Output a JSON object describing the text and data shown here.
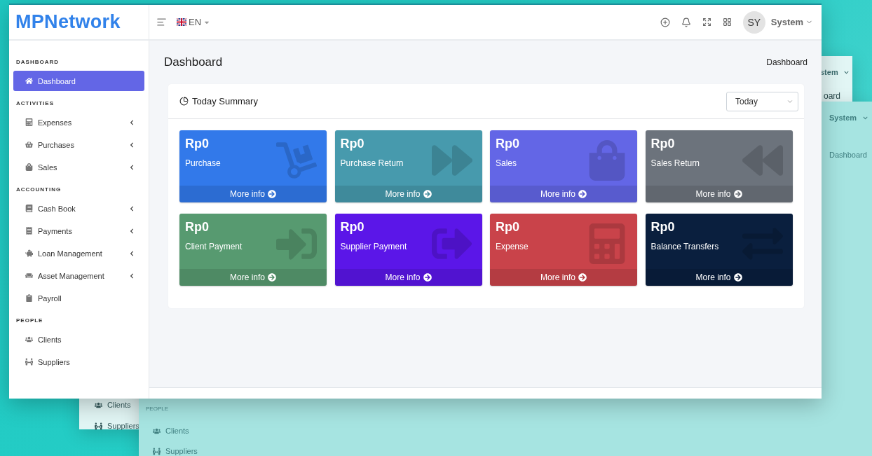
{
  "logo": "MPNetwork",
  "topbar": {
    "language": "EN",
    "avatar": "SY",
    "user": "System"
  },
  "sidebar": {
    "sections": [
      {
        "title": "DASHBOARD",
        "items": [
          {
            "label": "Dashboard",
            "selected": true,
            "expandable": false
          }
        ]
      },
      {
        "title": "ACTIVITIES",
        "items": [
          {
            "label": "Expenses",
            "selected": false,
            "expandable": true
          },
          {
            "label": "Purchases",
            "selected": false,
            "expandable": true
          },
          {
            "label": "Sales",
            "selected": false,
            "expandable": true
          }
        ]
      },
      {
        "title": "ACCOUNTING",
        "items": [
          {
            "label": "Cash Book",
            "selected": false,
            "expandable": true
          },
          {
            "label": "Payments",
            "selected": false,
            "expandable": true
          },
          {
            "label": "Loan Management",
            "selected": false,
            "expandable": true
          },
          {
            "label": "Asset Management",
            "selected": false,
            "expandable": true
          },
          {
            "label": "Payroll",
            "selected": false,
            "expandable": false
          }
        ]
      },
      {
        "title": "PEOPLE",
        "items": [
          {
            "label": "Clients",
            "selected": false,
            "expandable": false
          },
          {
            "label": "Suppliers",
            "selected": false,
            "expandable": false
          }
        ]
      }
    ]
  },
  "page": {
    "title": "Dashboard",
    "breadcrumb": "Dashboard"
  },
  "summary": {
    "title": "Today Summary",
    "period": {
      "value": "Today"
    },
    "cards": [
      {
        "amount": "Rp0",
        "label": "Purchase",
        "link": "More info",
        "color": "#3279ea"
      },
      {
        "amount": "Rp0",
        "label": "Purchase Return",
        "link": "More info",
        "color": "#479aad"
      },
      {
        "amount": "Rp0",
        "label": "Sales",
        "link": "More info",
        "color": "#6366e6"
      },
      {
        "amount": "Rp0",
        "label": "Sales Return",
        "link": "More info",
        "color": "#6c737c"
      },
      {
        "amount": "Rp0",
        "label": "Client Payment",
        "link": "More info",
        "color": "#579a70"
      },
      {
        "amount": "Rp0",
        "label": "Supplier Payment",
        "link": "More info",
        "color": "#5b16e8"
      },
      {
        "amount": "Rp0",
        "label": "Expense",
        "link": "More info",
        "color": "#c9434a"
      },
      {
        "amount": "Rp0",
        "label": "Balance Transfers",
        "link": "More info",
        "color": "#0a1f3e"
      }
    ]
  },
  "background_windows": [
    {
      "user": "stem",
      "breadcrumb": "oard",
      "people": [
        "Clients",
        "Suppliers"
      ]
    },
    {
      "user": "System",
      "breadcrumb": "Dashboard",
      "section": "PEOPLE",
      "people": [
        "Clients",
        "Suppliers"
      ]
    }
  ]
}
